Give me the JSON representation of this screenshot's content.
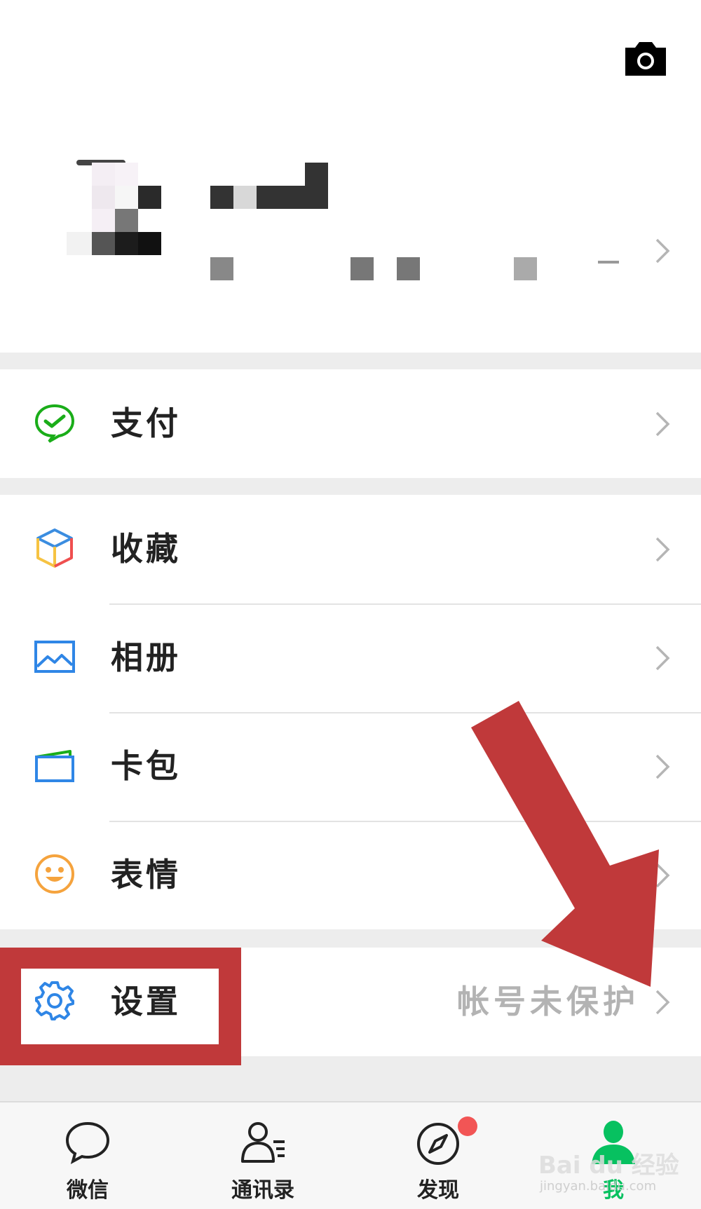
{
  "profile": {
    "camera_icon": "camera-icon"
  },
  "menu": {
    "pay": "支付",
    "favorites": "收藏",
    "album": "相册",
    "cards": "卡包",
    "stickers": "表情",
    "settings": "设置",
    "settings_hint": "帐号未保护"
  },
  "tabs": [
    {
      "label": "微信",
      "icon": "chat-bubble-icon"
    },
    {
      "label": "通讯录",
      "icon": "contacts-icon"
    },
    {
      "label": "发现",
      "icon": "compass-icon"
    },
    {
      "label": "我",
      "icon": "person-icon"
    }
  ],
  "watermark": {
    "text": "Bai du 经验",
    "sub": "jingyan.baidu.com"
  },
  "colors": {
    "accent": "#07c160",
    "annotation": "#c0393a",
    "badge": "#f25555"
  }
}
